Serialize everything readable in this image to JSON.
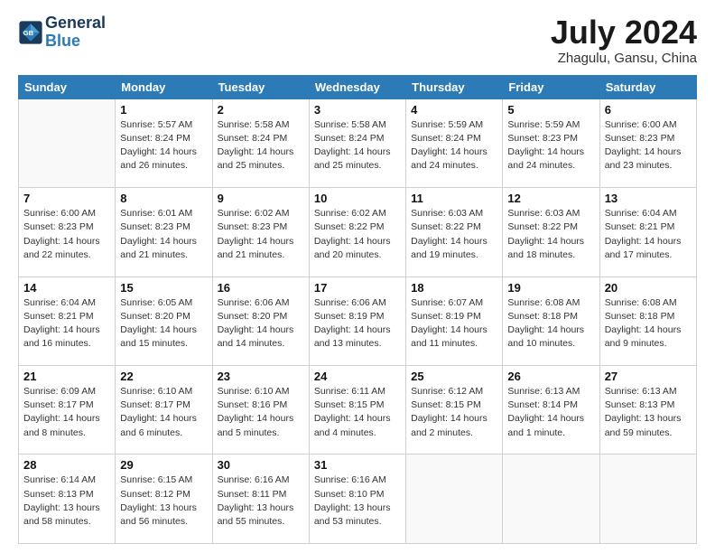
{
  "logo": {
    "line1": "General",
    "line2": "Blue"
  },
  "title": "July 2024",
  "subtitle": "Zhagulu, Gansu, China",
  "weekdays": [
    "Sunday",
    "Monday",
    "Tuesday",
    "Wednesday",
    "Thursday",
    "Friday",
    "Saturday"
  ],
  "weeks": [
    [
      {
        "day": "",
        "info": ""
      },
      {
        "day": "1",
        "info": "Sunrise: 5:57 AM\nSunset: 8:24 PM\nDaylight: 14 hours\nand 26 minutes."
      },
      {
        "day": "2",
        "info": "Sunrise: 5:58 AM\nSunset: 8:24 PM\nDaylight: 14 hours\nand 25 minutes."
      },
      {
        "day": "3",
        "info": "Sunrise: 5:58 AM\nSunset: 8:24 PM\nDaylight: 14 hours\nand 25 minutes."
      },
      {
        "day": "4",
        "info": "Sunrise: 5:59 AM\nSunset: 8:24 PM\nDaylight: 14 hours\nand 24 minutes."
      },
      {
        "day": "5",
        "info": "Sunrise: 5:59 AM\nSunset: 8:23 PM\nDaylight: 14 hours\nand 24 minutes."
      },
      {
        "day": "6",
        "info": "Sunrise: 6:00 AM\nSunset: 8:23 PM\nDaylight: 14 hours\nand 23 minutes."
      }
    ],
    [
      {
        "day": "7",
        "info": "Sunrise: 6:00 AM\nSunset: 8:23 PM\nDaylight: 14 hours\nand 22 minutes."
      },
      {
        "day": "8",
        "info": "Sunrise: 6:01 AM\nSunset: 8:23 PM\nDaylight: 14 hours\nand 21 minutes."
      },
      {
        "day": "9",
        "info": "Sunrise: 6:02 AM\nSunset: 8:23 PM\nDaylight: 14 hours\nand 21 minutes."
      },
      {
        "day": "10",
        "info": "Sunrise: 6:02 AM\nSunset: 8:22 PM\nDaylight: 14 hours\nand 20 minutes."
      },
      {
        "day": "11",
        "info": "Sunrise: 6:03 AM\nSunset: 8:22 PM\nDaylight: 14 hours\nand 19 minutes."
      },
      {
        "day": "12",
        "info": "Sunrise: 6:03 AM\nSunset: 8:22 PM\nDaylight: 14 hours\nand 18 minutes."
      },
      {
        "day": "13",
        "info": "Sunrise: 6:04 AM\nSunset: 8:21 PM\nDaylight: 14 hours\nand 17 minutes."
      }
    ],
    [
      {
        "day": "14",
        "info": "Sunrise: 6:04 AM\nSunset: 8:21 PM\nDaylight: 14 hours\nand 16 minutes."
      },
      {
        "day": "15",
        "info": "Sunrise: 6:05 AM\nSunset: 8:20 PM\nDaylight: 14 hours\nand 15 minutes."
      },
      {
        "day": "16",
        "info": "Sunrise: 6:06 AM\nSunset: 8:20 PM\nDaylight: 14 hours\nand 14 minutes."
      },
      {
        "day": "17",
        "info": "Sunrise: 6:06 AM\nSunset: 8:19 PM\nDaylight: 14 hours\nand 13 minutes."
      },
      {
        "day": "18",
        "info": "Sunrise: 6:07 AM\nSunset: 8:19 PM\nDaylight: 14 hours\nand 11 minutes."
      },
      {
        "day": "19",
        "info": "Sunrise: 6:08 AM\nSunset: 8:18 PM\nDaylight: 14 hours\nand 10 minutes."
      },
      {
        "day": "20",
        "info": "Sunrise: 6:08 AM\nSunset: 8:18 PM\nDaylight: 14 hours\nand 9 minutes."
      }
    ],
    [
      {
        "day": "21",
        "info": "Sunrise: 6:09 AM\nSunset: 8:17 PM\nDaylight: 14 hours\nand 8 minutes."
      },
      {
        "day": "22",
        "info": "Sunrise: 6:10 AM\nSunset: 8:17 PM\nDaylight: 14 hours\nand 6 minutes."
      },
      {
        "day": "23",
        "info": "Sunrise: 6:10 AM\nSunset: 8:16 PM\nDaylight: 14 hours\nand 5 minutes."
      },
      {
        "day": "24",
        "info": "Sunrise: 6:11 AM\nSunset: 8:15 PM\nDaylight: 14 hours\nand 4 minutes."
      },
      {
        "day": "25",
        "info": "Sunrise: 6:12 AM\nSunset: 8:15 PM\nDaylight: 14 hours\nand 2 minutes."
      },
      {
        "day": "26",
        "info": "Sunrise: 6:13 AM\nSunset: 8:14 PM\nDaylight: 14 hours\nand 1 minute."
      },
      {
        "day": "27",
        "info": "Sunrise: 6:13 AM\nSunset: 8:13 PM\nDaylight: 13 hours\nand 59 minutes."
      }
    ],
    [
      {
        "day": "28",
        "info": "Sunrise: 6:14 AM\nSunset: 8:13 PM\nDaylight: 13 hours\nand 58 minutes."
      },
      {
        "day": "29",
        "info": "Sunrise: 6:15 AM\nSunset: 8:12 PM\nDaylight: 13 hours\nand 56 minutes."
      },
      {
        "day": "30",
        "info": "Sunrise: 6:16 AM\nSunset: 8:11 PM\nDaylight: 13 hours\nand 55 minutes."
      },
      {
        "day": "31",
        "info": "Sunrise: 6:16 AM\nSunset: 8:10 PM\nDaylight: 13 hours\nand 53 minutes."
      },
      {
        "day": "",
        "info": ""
      },
      {
        "day": "",
        "info": ""
      },
      {
        "day": "",
        "info": ""
      }
    ]
  ]
}
